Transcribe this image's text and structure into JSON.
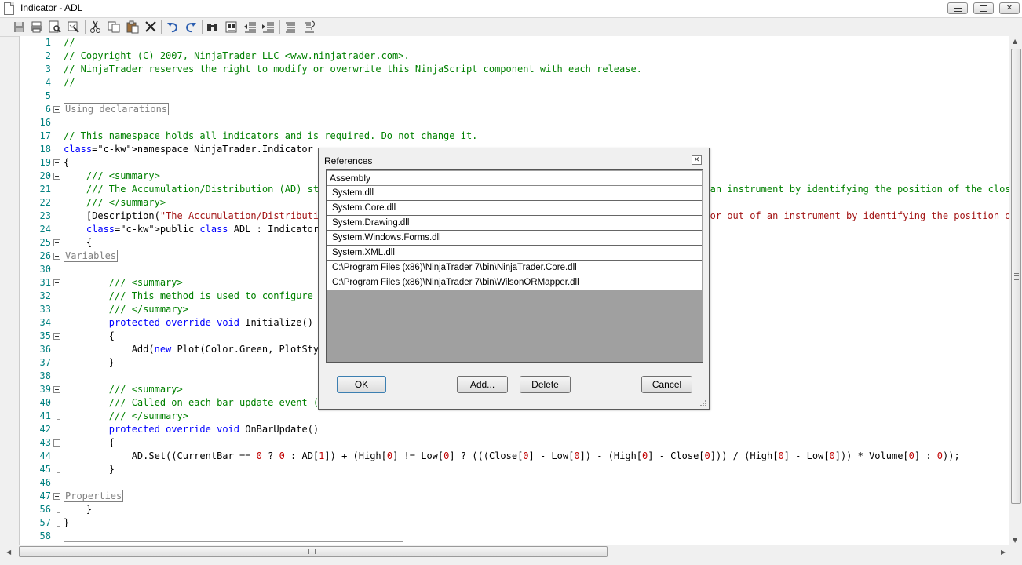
{
  "window": {
    "title": "Indicator - ADL",
    "minimize_glyph": "▭",
    "maximize_glyph": "▢",
    "close_glyph": "✕"
  },
  "toolbar": {
    "buttons": [
      "save-icon",
      "print-icon",
      "print-preview-icon",
      "compile-icon",
      "cut-icon",
      "copy-icon",
      "paste-icon",
      "delete-icon",
      "undo-icon",
      "redo-icon",
      "find-icon",
      "find-replace-icon",
      "outdent-icon",
      "indent-icon",
      "comment-icon",
      "uncomment-icon"
    ]
  },
  "editor": {
    "lines": [
      {
        "num": "1",
        "code": "//"
      },
      {
        "num": "2",
        "code": "// Copyright (C) 2007, NinjaTrader LLC <www.ninjatrader.com>."
      },
      {
        "num": "3",
        "code": "// NinjaTrader reserves the right to modify or overwrite this NinjaScript component with each release."
      },
      {
        "num": "4",
        "code": "//"
      },
      {
        "num": "5",
        "code": ""
      },
      {
        "num": "6",
        "code": "Using declarations"
      },
      {
        "num": "16",
        "code": ""
      },
      {
        "num": "17",
        "code": "// This namespace holds all indicators and is required. Do not change it."
      },
      {
        "num": "18",
        "code": "namespace NinjaTrader.Indicator"
      },
      {
        "num": "19",
        "code": "{"
      },
      {
        "num": "20",
        "code": "    /// <summary>"
      },
      {
        "num": "21",
        "code": "    /// The Accumulation/Distribution (AD) study attempts to quantify the amount of volume flowing into or out of an instrument by identifying the position of the close of the period in relation to that period's high/low range."
      },
      {
        "num": "22",
        "code": "    /// </summary>"
      },
      {
        "num": "23",
        "code": "    [Description(\"The Accumulation/Distribution (AD) study attempts to quantify the amount of volume flowing into or out of an instrument by identifying the position of the close of the period in relation to that period's high/low range.\")]"
      },
      {
        "num": "24",
        "code": "    public class ADL : Indicator"
      },
      {
        "num": "25",
        "code": "    {"
      },
      {
        "num": "26",
        "code": "Variables"
      },
      {
        "num": "30",
        "code": ""
      },
      {
        "num": "31",
        "code": "        /// <summary>"
      },
      {
        "num": "32",
        "code": "        /// This method is used to configure the indicator and is called once before any bar data is loaded."
      },
      {
        "num": "33",
        "code": "        /// </summary>"
      },
      {
        "num": "34",
        "code": "        protected override void Initialize()"
      },
      {
        "num": "35",
        "code": "        {"
      },
      {
        "num": "36",
        "code": "            Add(new Plot(Color.Green, PlotStyle.Line, \"AD\"));"
      },
      {
        "num": "37",
        "code": "        }"
      },
      {
        "num": "38",
        "code": ""
      },
      {
        "num": "39",
        "code": "        /// <summary>"
      },
      {
        "num": "40",
        "code": "        /// Called on each bar update event (incoming tick)."
      },
      {
        "num": "41",
        "code": "        /// </summary>"
      },
      {
        "num": "42",
        "code": "        protected override void OnBarUpdate()"
      },
      {
        "num": "43",
        "code": "        {"
      },
      {
        "num": "44",
        "code": "            AD.Set((CurrentBar == 0 ? 0 : AD[1]) + (High[0] != Low[0] ? (((Close[0] - Low[0]) - (High[0] - Close[0])) / (High[0] - Low[0])) * Volume[0] : 0));"
      },
      {
        "num": "45",
        "code": "        }"
      },
      {
        "num": "46",
        "code": ""
      },
      {
        "num": "47",
        "code": "Properties"
      },
      {
        "num": "56",
        "code": "    }"
      },
      {
        "num": "57",
        "code": "}"
      },
      {
        "num": "58",
        "code": ""
      }
    ]
  },
  "dialog": {
    "title": "References",
    "close_glyph": "✕",
    "column_header": "Assembly",
    "assemblies": [
      "System.dll",
      "System.Core.dll",
      "System.Drawing.dll",
      "System.Windows.Forms.dll",
      "System.XML.dll",
      "C:\\Program Files (x86)\\NinjaTrader 7\\bin\\NinjaTrader.Core.dll",
      "C:\\Program Files (x86)\\NinjaTrader 7\\bin\\WilsonORMapper.dll"
    ],
    "ok_label": "OK",
    "add_label": "Add...",
    "delete_label": "Delete",
    "cancel_label": "Cancel"
  }
}
